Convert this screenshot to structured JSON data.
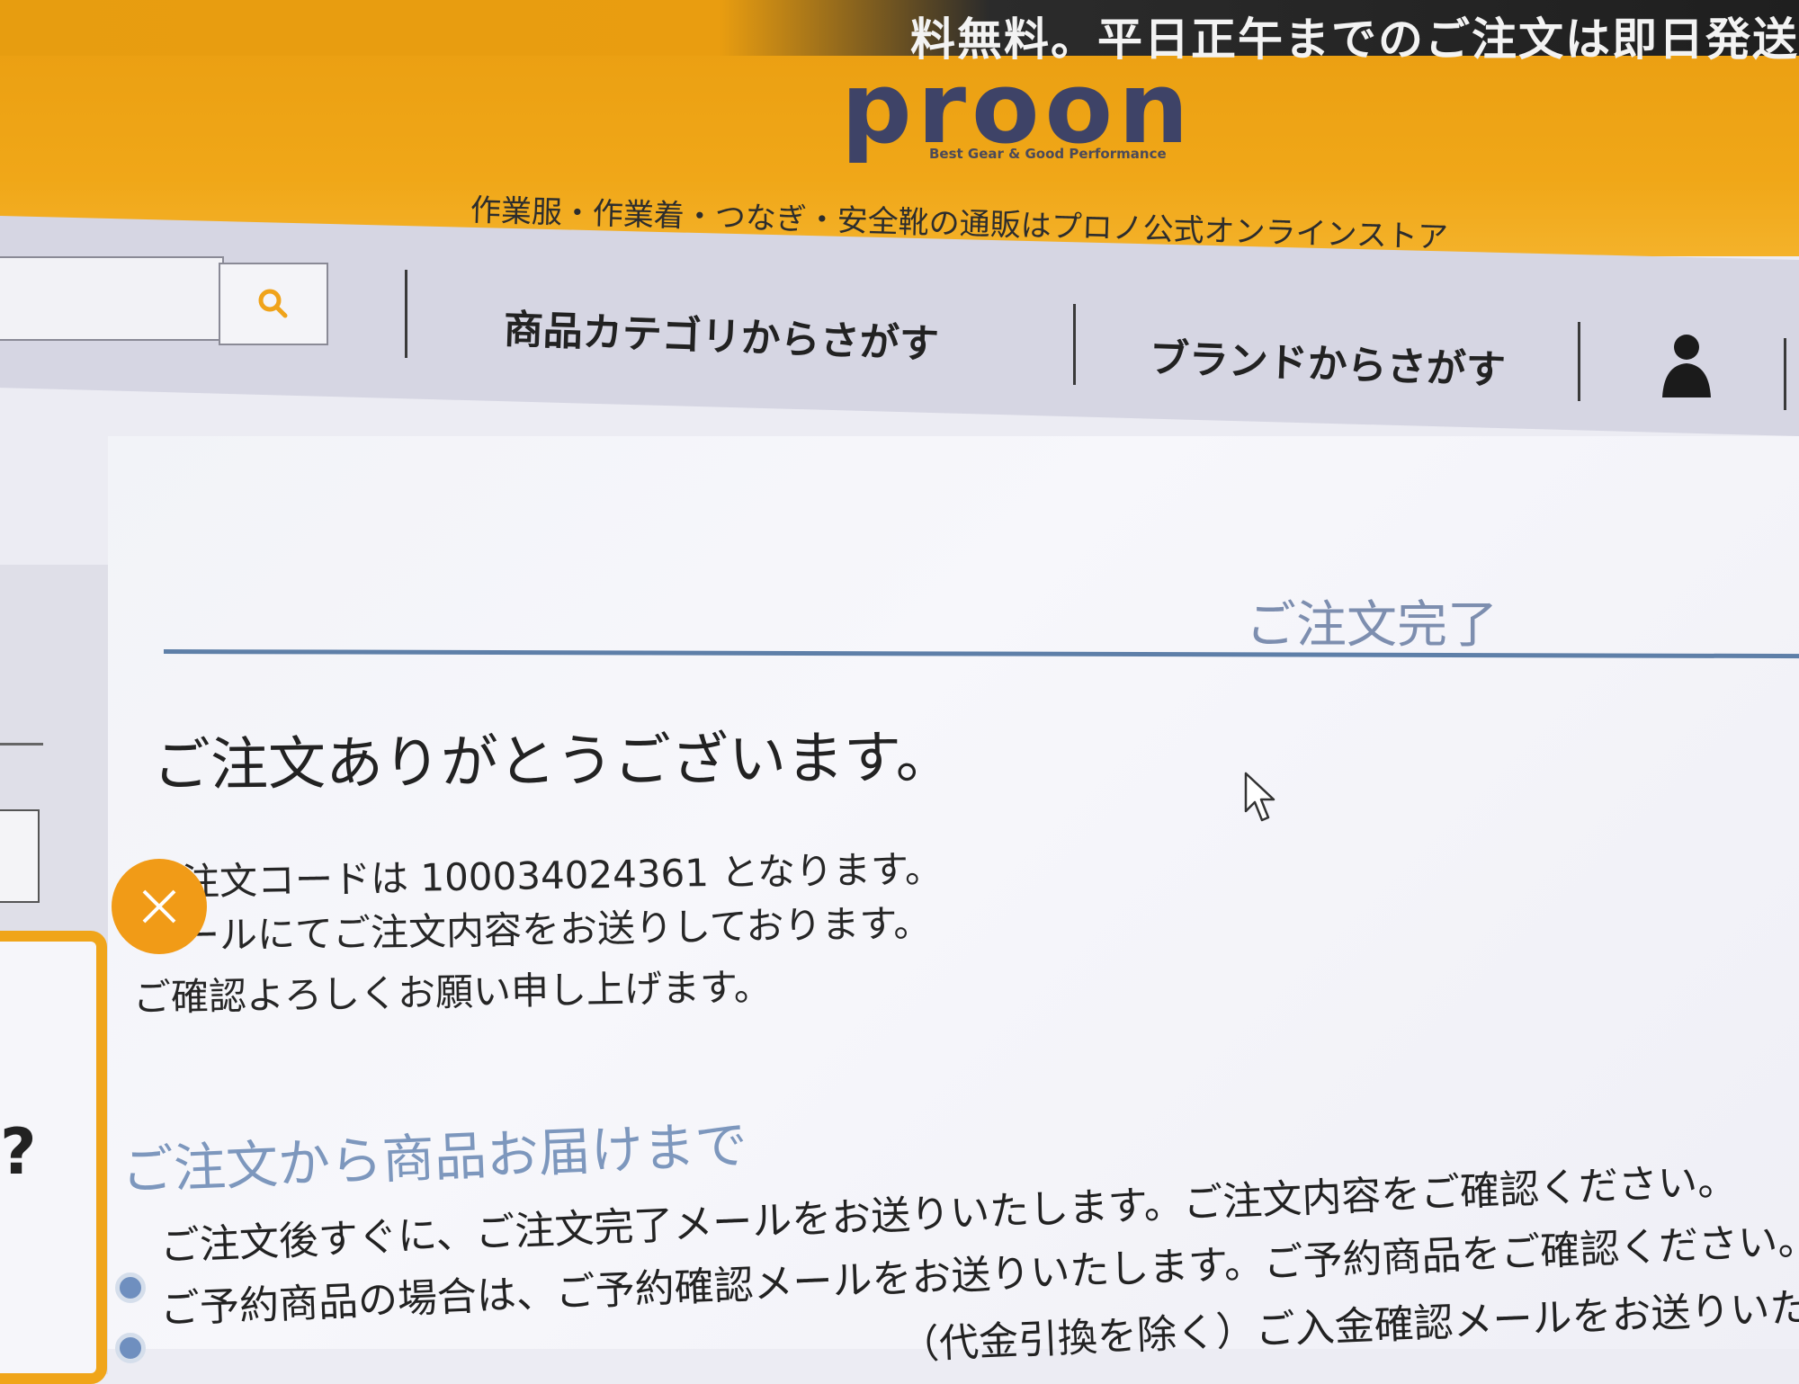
{
  "promo": {
    "text": "料無料。平日正午までのご注文は即日発送"
  },
  "header": {
    "logo_text": "proon",
    "logo_tagline": "Best Gear & Good Performance",
    "site_tagline": "作業服・作業着・つなぎ・安全靴の通販はプロノ公式オンラインストア"
  },
  "nav": {
    "search_placeholder": "",
    "category_label": "商品カテゴリからさがす",
    "brand_label": "ブランドからさがす"
  },
  "sidebar": {
    "question_mark": "?"
  },
  "main": {
    "section_title": "ご注文完了",
    "thanks": "ご注文ありがとうございます。",
    "order_code_line": "ご注文コードは 100034024361 となります。",
    "email_line": "メールにてご注文内容をお送りしております。",
    "confirm_line": "ご確認よろしくお願い申し上げます。",
    "flow_title": "ご注文から商品お届けまで",
    "flow_items": [
      "ご注文後すぐに、ご注文完了メールをお送りいたします。ご注文内容をご確認ください。",
      "ご予約商品の場合は、ご予約確認メールをお送りいたします。ご予約商品をご確認ください。",
      "（代金引換を除く）ご入金確認メールをお送りいたします"
    ]
  },
  "colors": {
    "brand_orange": "#f0a718",
    "accent_blue": "#5e7fa8",
    "navy_logo": "#3e4367"
  }
}
